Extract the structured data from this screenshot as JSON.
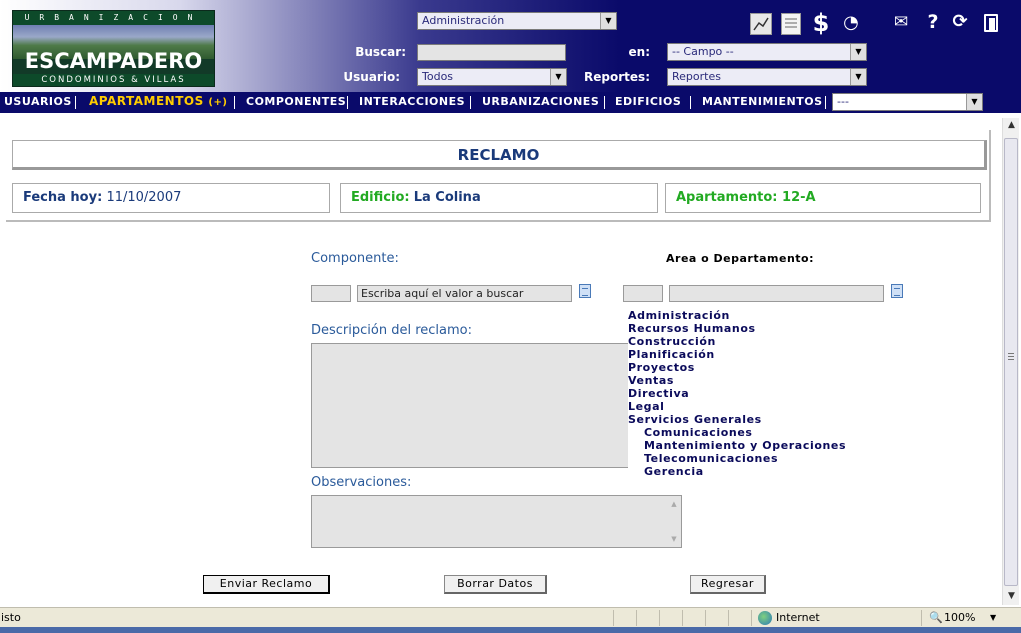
{
  "logo": {
    "top_text": "URBANIZACION",
    "name": "ESCAMPADERO",
    "subtitle": "CONDOMINIOS & VILLAS"
  },
  "header": {
    "top_select_value": "Administración",
    "buscar_label": "Buscar:",
    "buscar_value": "",
    "en_label": "en:",
    "en_select_value": "-- Campo --",
    "usuario_label": "Usuario:",
    "usuario_select_value": "Todos",
    "reportes_label": "Reportes:",
    "reportes_select_value": "Reportes",
    "icons": [
      "chart-icon",
      "document-icon",
      "dollar-icon",
      "clock-icon",
      "mail-icon",
      "help-icon",
      "refresh-icon",
      "exit-icon"
    ],
    "icon_glyphs": {
      "dollar": "$",
      "help": "?",
      "clock": "◔",
      "refresh": "⟳",
      "mail": "✉"
    }
  },
  "nav": {
    "items": [
      "USUARIOS",
      "APARTAMENTOS",
      "COMPONENTES",
      "INTERACCIONES",
      "URBANIZACIONES",
      "EDIFICIOS",
      "MANTENIMIENTOS"
    ],
    "active_suffix": "(+)",
    "select_value": "---"
  },
  "form": {
    "title": "RECLAMO",
    "fecha_label": "Fecha hoy:",
    "fecha_value": "11/10/2007",
    "edificio_label": "Edificio:",
    "edificio_value": "La Colina",
    "apartamento_label": "Apartamento:",
    "apartamento_value": "12-A",
    "componente_label": "Componente:",
    "componente_code": "",
    "componente_search": "Escriba aquí el valor a buscar",
    "area_label": "Area o Departamento:",
    "area_code": "",
    "area_value": "",
    "descripcion_label": "Descripción del reclamo:",
    "observaciones_label": "Observaciones:"
  },
  "departments": [
    {
      "label": "Administración",
      "level": 0
    },
    {
      "label": "Recursos Humanos",
      "level": 0
    },
    {
      "label": "Construcción",
      "level": 0
    },
    {
      "label": "Planificación",
      "level": 0
    },
    {
      "label": "Proyectos",
      "level": 0
    },
    {
      "label": "Ventas",
      "level": 0
    },
    {
      "label": "Directiva",
      "level": 0
    },
    {
      "label": "Legal",
      "level": 0
    },
    {
      "label": "Servicios Generales",
      "level": 0
    },
    {
      "label": "Comunicaciones",
      "level": 1
    },
    {
      "label": "Mantenimiento y Operaciones",
      "level": 1
    },
    {
      "label": "Telecomunicaciones",
      "level": 1
    },
    {
      "label": "Gerencia",
      "level": 1
    }
  ],
  "buttons": {
    "enviar": "Enviar Reclamo",
    "borrar": "Borrar Datos",
    "regresar": "Regresar"
  },
  "statusbar": {
    "status_text": "isto",
    "zone": "Internet",
    "zoom": "100%"
  },
  "colors": {
    "header_dark": "#0a0a6a",
    "nav_active": "#ffcc00",
    "label_blue": "#1a3a7a",
    "label_green": "#22aa22"
  }
}
